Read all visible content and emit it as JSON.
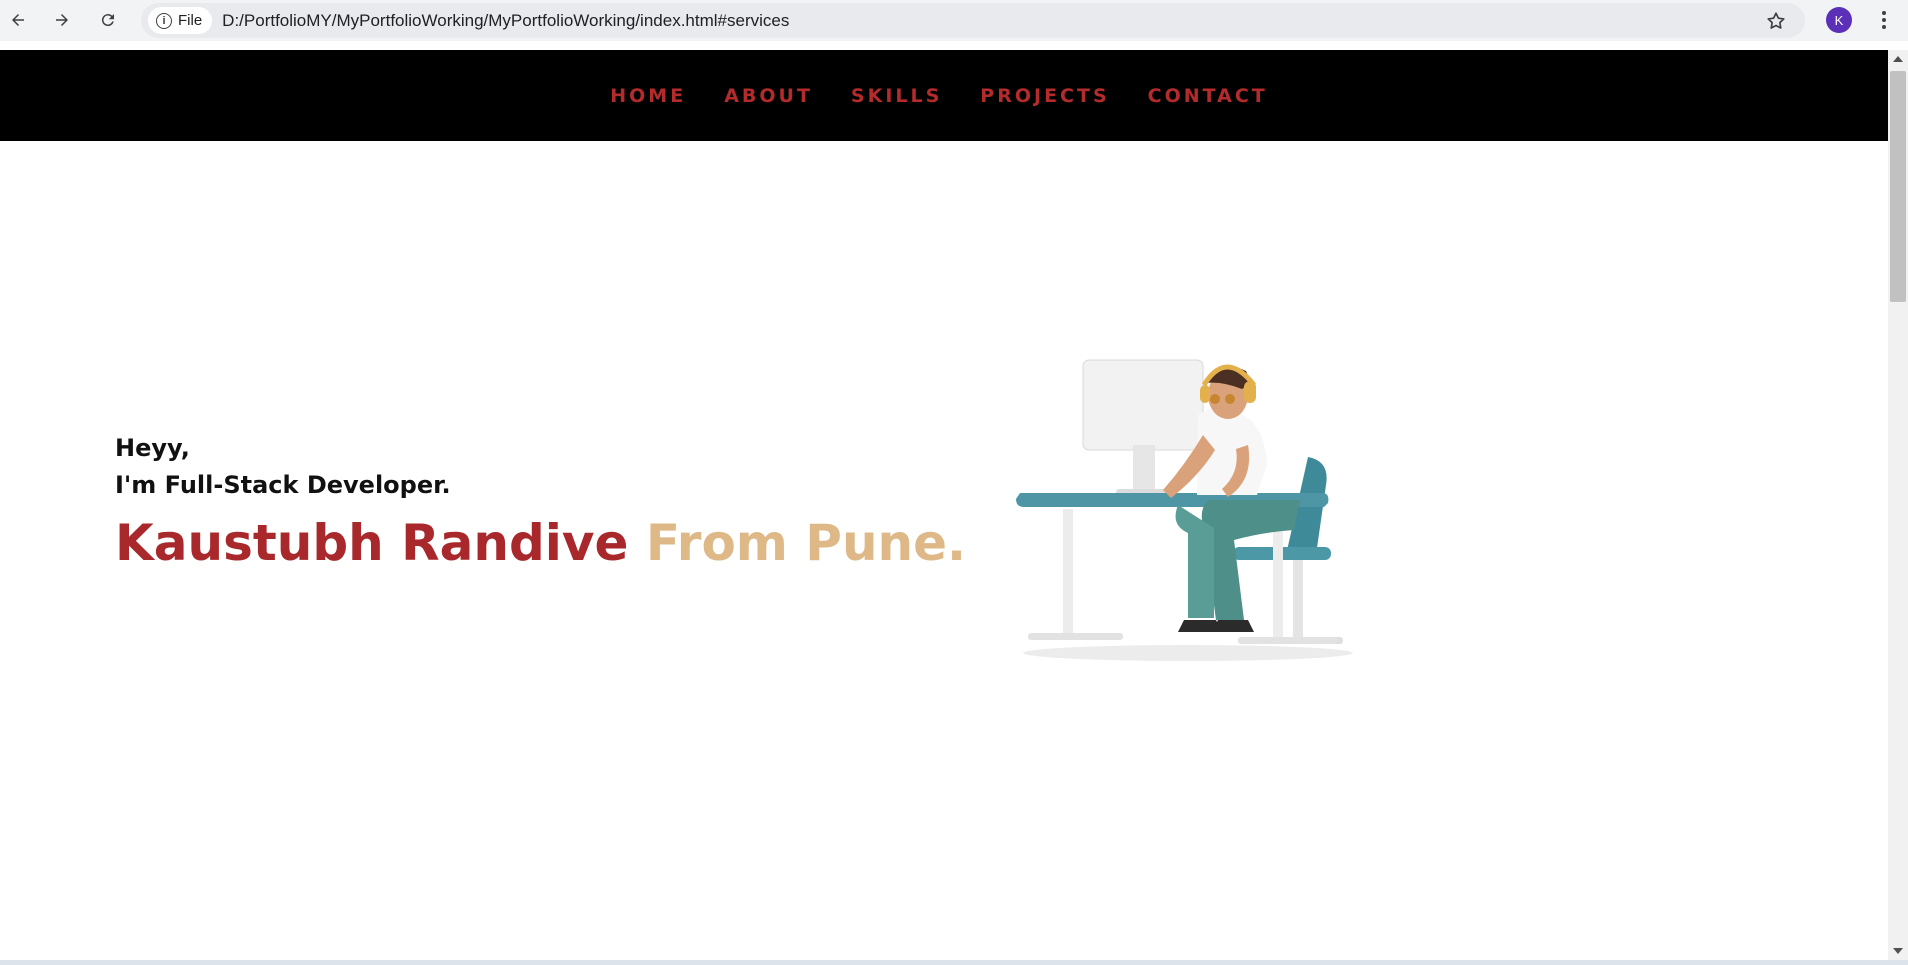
{
  "browser": {
    "chip_label": "File",
    "url": "D:/PortfolioMY/MyPortfolioWorking/MyPortfolioWorking/index.html#services",
    "profile_initial": "K",
    "profile_color": "#5b2fb8"
  },
  "nav": {
    "items": [
      "HOME",
      "ABOUT",
      "SKILLS",
      "PROJECTS",
      "CONTACT"
    ],
    "color": "#b32b2b"
  },
  "hero": {
    "greeting_line1": "Heyy,",
    "greeting_line2": "I'm Full-Stack Developer.",
    "name": "Kaustubh Randive",
    "city": "From Pune.",
    "name_color": "#a8282b",
    "city_color": "#deb887"
  },
  "icons": [
    "back-arrow-icon",
    "forward-arrow-icon",
    "reload-icon",
    "info-icon",
    "star-icon",
    "more-vert-icon"
  ]
}
